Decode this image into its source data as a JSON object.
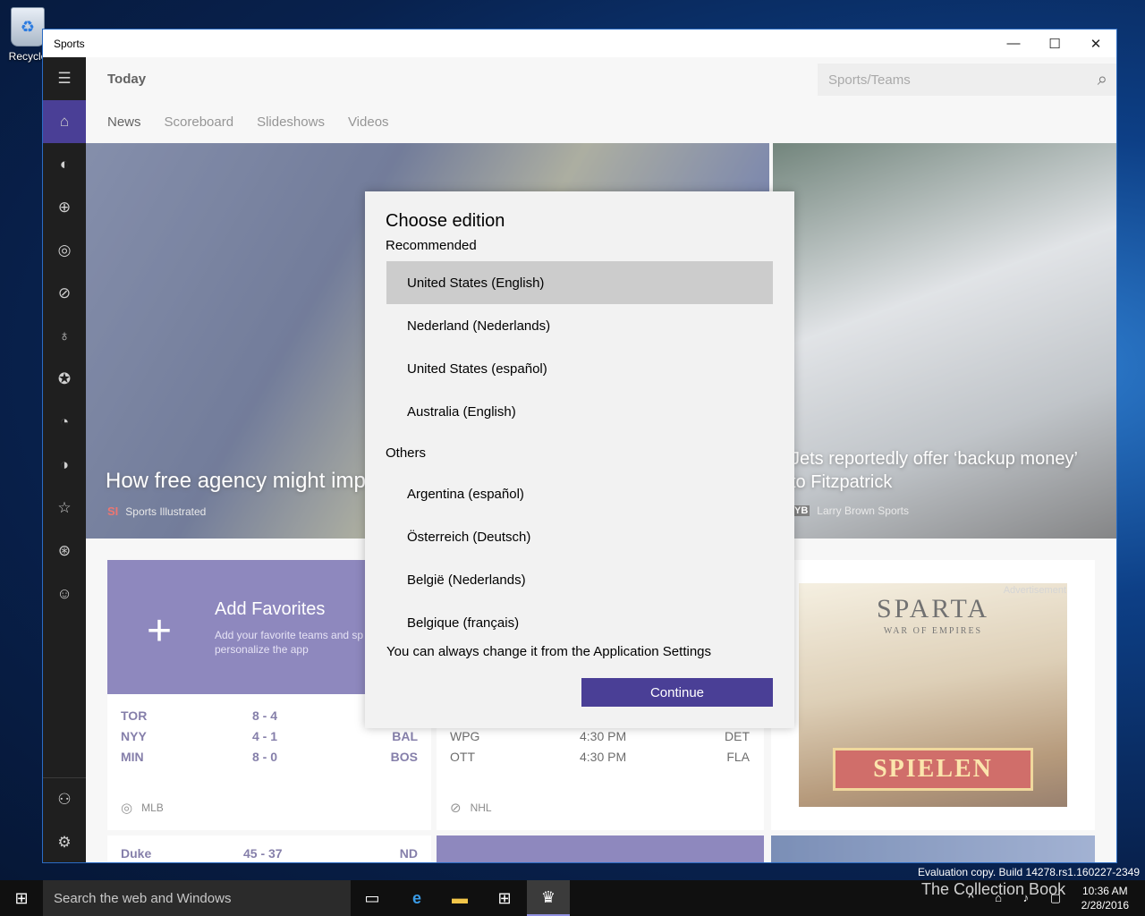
{
  "desktop": {
    "recycle_label": "Recycle",
    "eval_text": "Evaluation copy. Build 14278.rs1.160227-2349",
    "watermark": "The Collection Book"
  },
  "window": {
    "title": "Sports",
    "minimize": "—",
    "maximize": "☐",
    "close": "✕"
  },
  "topbar": {
    "page_title": "Today",
    "search_placeholder": "Sports/Teams"
  },
  "tabs": [
    "News",
    "Scoreboard",
    "Slideshows",
    "Videos"
  ],
  "hero": {
    "left_caption": "How free agency might imp",
    "left_source_badge": "SI",
    "left_source": "Sports Illustrated",
    "right_caption_line1": "Jets reportedly offer ‘backup money’",
    "right_caption_line2": "to Fitzpatrick",
    "right_source_badge": "YB",
    "right_source": "Larry Brown Sports"
  },
  "favorites": {
    "title": "Add Favorites",
    "subtitle_line1": "Add your favorite teams and sp",
    "subtitle_line2": "personalize the app"
  },
  "mlb": {
    "league": "MLB",
    "rows": [
      {
        "team": "TOR",
        "score": "8  -  4",
        "opp": ""
      },
      {
        "team": "NYY",
        "score": "4  -  1",
        "opp": "BAL"
      },
      {
        "team": "MIN",
        "score": "8  -  0",
        "opp": "BOS"
      }
    ]
  },
  "nhl": {
    "league": "NHL",
    "rows": [
      {
        "team": "WPG",
        "time": "4:30 PM",
        "opp": "DET"
      },
      {
        "team": "OTT",
        "time": "4:30 PM",
        "opp": "FLA"
      }
    ]
  },
  "ncaa": {
    "team": "Duke",
    "score": "45  -  37",
    "opp": "ND"
  },
  "ad": {
    "label": "Advertisement",
    "title": "SPARTA",
    "subtitle": "WAR OF EMPIRES",
    "cta": "SPIELEN"
  },
  "dialog": {
    "title": "Choose edition",
    "recommended_label": "Recommended",
    "recommended": [
      "United States (English)",
      "Nederland (Nederlands)",
      "United States (español)",
      "Australia (English)"
    ],
    "others_label": "Others",
    "others": [
      "Argentina (español)",
      "Österreich (Deutsch)",
      "België (Nederlands)",
      "Belgique (français)"
    ],
    "note": "You can always change it from the Application Settings",
    "continue_label": "Continue",
    "selected_index": 0
  },
  "taskbar": {
    "search_placeholder": "Search the web and Windows",
    "time": "10:36 AM",
    "date": "2/28/2016"
  },
  "colors": {
    "accent": "#4a3f96",
    "rail": "#1f1f1f",
    "selected_row": "#cccccc"
  }
}
